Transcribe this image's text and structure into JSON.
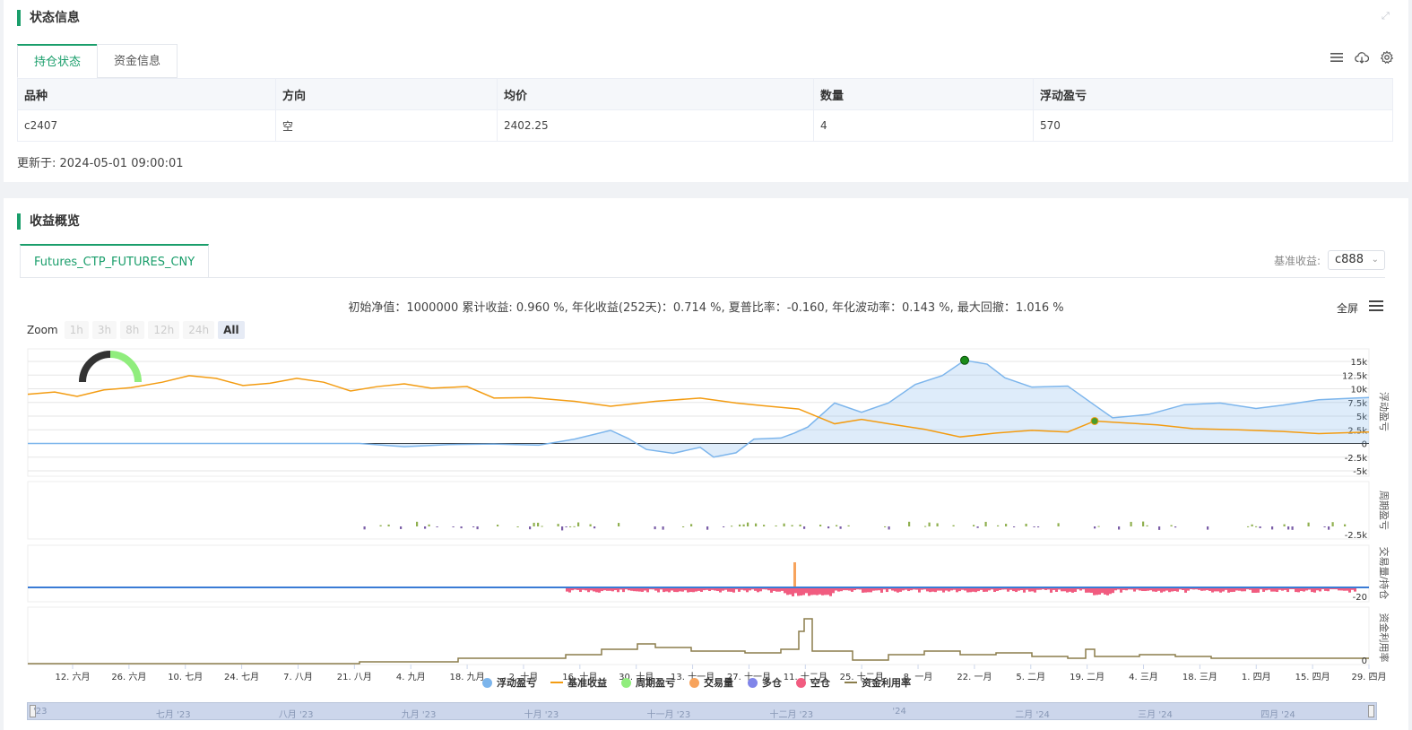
{
  "status": {
    "title": "状态信息",
    "tabs": [
      {
        "label": "持仓状态"
      },
      {
        "label": "资金信息"
      }
    ],
    "table": {
      "headers": [
        "品种",
        "方向",
        "均价",
        "数量",
        "浮动盈亏"
      ],
      "rows": [
        [
          "c2407",
          "空",
          "2402.25",
          "4",
          "570"
        ]
      ]
    },
    "updated": "更新于: 2024-05-01 09:00:01"
  },
  "profit": {
    "title": "收益概览",
    "tab": "Futures_CTP_FUTURES_CNY",
    "benchmark_label": "基准收益:",
    "benchmark_value": "c888",
    "stats_text": "初始净值：1000000 累计收益: 0.960 %, 年化收益(252天)：0.714 %, 夏普比率：-0.160, 年化波动率：0.143 %, 最大回撤：1.016 %",
    "fullscreen": "全屏",
    "zoom_label": "Zoom",
    "zoom_buttons": [
      "1h",
      "3h",
      "8h",
      "12h",
      "24h",
      "All"
    ],
    "zoom_active": "All",
    "legend": [
      "浮动盈亏",
      "基准收益",
      "周期盈亏",
      "交易量",
      "多仓",
      "空仓",
      "资金利用率"
    ],
    "navigator_labels": [
      "'23",
      "七月 '23",
      "八月 '23",
      "九月 '23",
      "十月 '23",
      "十一月 '23",
      "十二月 '23",
      "'24",
      "二月 '24",
      "三月 '24",
      "四月 '24"
    ]
  },
  "colors": {
    "accent": "#1a9e6b",
    "float_pnl": "#7cb5ec",
    "benchmark": "#f39c12",
    "period_pos": "#90b050",
    "period_neg": "#7b5ea7",
    "volume": "#f7a35c",
    "long": "#8085e9",
    "short": "#f15c80",
    "utilization": "#8b7d4b"
  },
  "chart_data": {
    "type": "line",
    "x_ticks": [
      "12. 六月",
      "26. 六月",
      "10. 七月",
      "24. 七月",
      "7. 八月",
      "21. 八月",
      "4. 九月",
      "18. 九月",
      "2. 十月",
      "16. 十月",
      "30. 十月",
      "13. 十一月",
      "27. 十一月",
      "11. 十二月",
      "25. 十二月",
      "8. 一月",
      "22. 一月",
      "5. 二月",
      "19. 二月",
      "4. 三月",
      "18. 三月",
      "1. 四月",
      "15. 四月",
      "29. 四月"
    ],
    "panes": [
      {
        "name": "浮动盈亏",
        "y_ticks": [
          "15k",
          "12.5k",
          "10k",
          "7.5k",
          "5k",
          "2.5k",
          "0",
          "-2.5k",
          "-5k"
        ],
        "ylim": [
          -5000,
          15000
        ]
      },
      {
        "name": "周期盈亏",
        "y_ticks": [
          "-2.5k"
        ]
      },
      {
        "name": "交易量/持仓",
        "y_ticks": [
          "-20"
        ]
      },
      {
        "name": "资金利用率",
        "y_ticks": [
          "0"
        ]
      }
    ]
  }
}
